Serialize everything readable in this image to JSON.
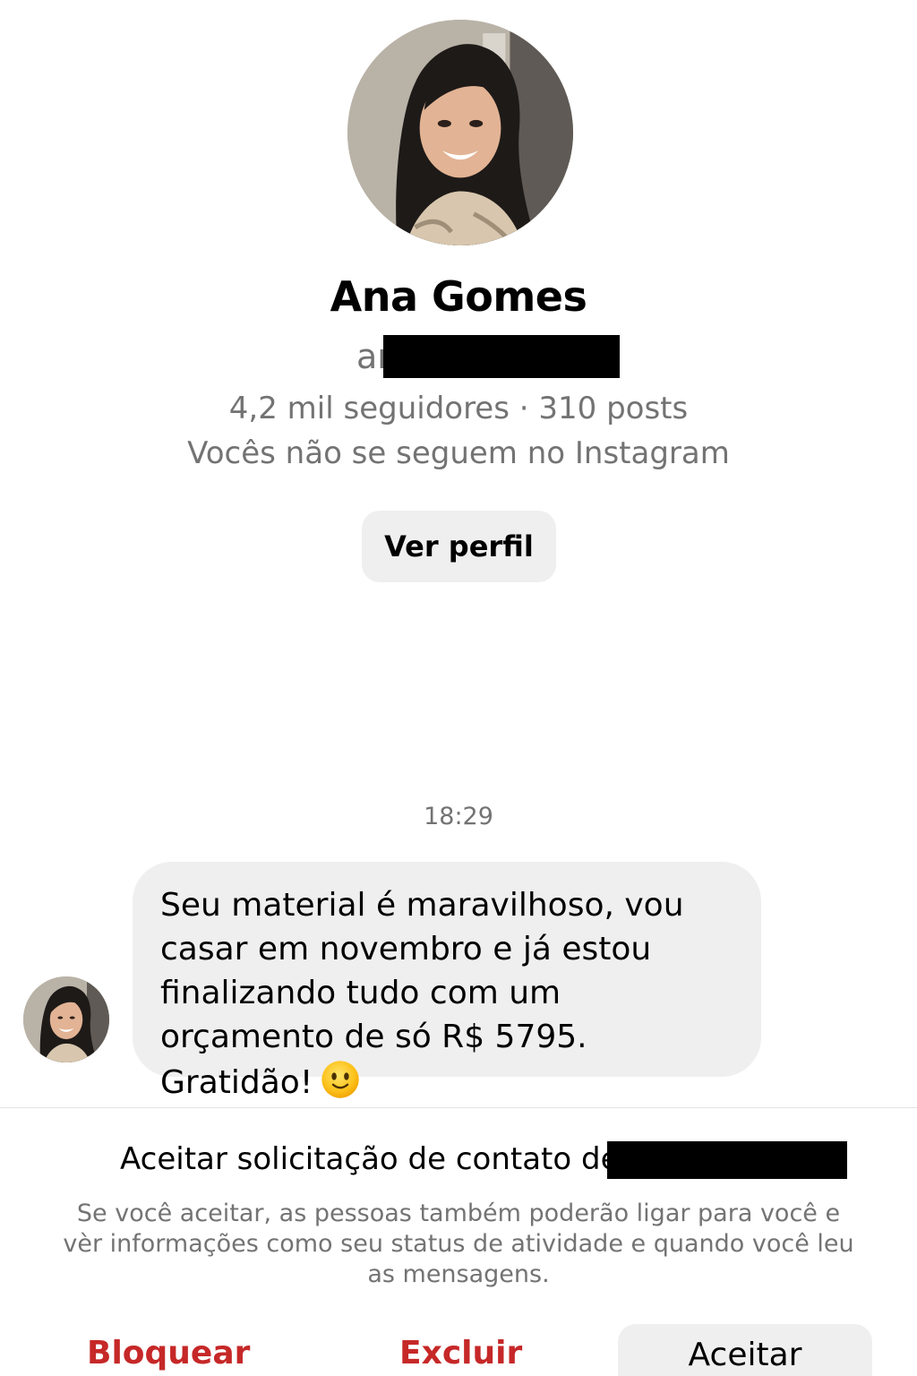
{
  "profile": {
    "name": "Ana Gomes",
    "username_visible": "ar",
    "username_redacted": true,
    "stats": "4,2 mil seguidores · 310 posts",
    "follow_status": "Vocês não se seguem no Instagram",
    "view_profile_label": "Ver perfil"
  },
  "conversation": {
    "timestamp": "18:29",
    "messages": [
      {
        "sender": "Ana Gomes",
        "text": "Seu material é maravilhoso, vou casar em novembro e já estou finalizando tudo com um orçamento de só R$ 5795. Gratidão!",
        "emoji": "slightly-smiling-face-icon"
      }
    ]
  },
  "request": {
    "title": "Aceitar solicitação de contato de",
    "title_redacted": true,
    "note": "Se você aceitar, as pessoas também poderão ligar para você e vèr informações como seu status de atividade e quando você leu as mensagens.",
    "actions": {
      "block": "Bloquear",
      "delete": "Excluir",
      "accept": "Aceitar"
    }
  },
  "colors": {
    "destructive": "#c62828",
    "secondary_text": "#737373",
    "button_background": "#efefef",
    "bubble_background": "#efefef"
  }
}
